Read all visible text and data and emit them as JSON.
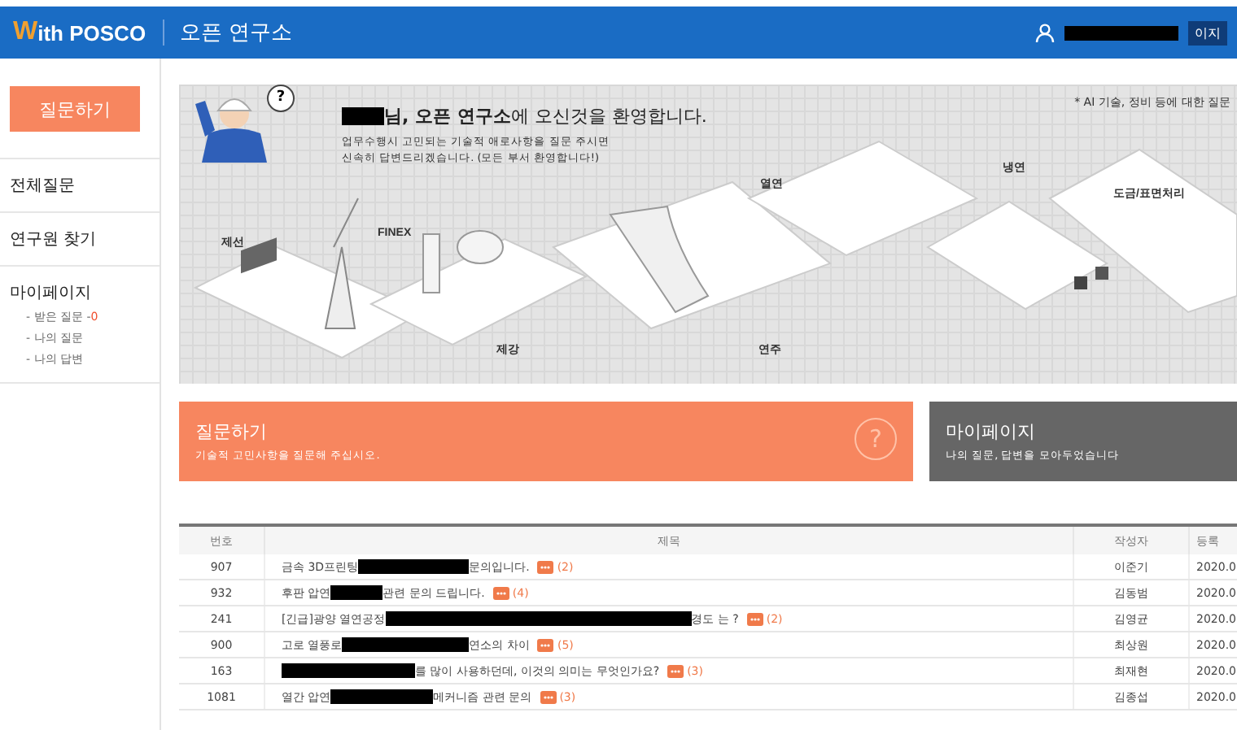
{
  "header": {
    "logo_mark": "W",
    "logo_text": "ith POSCO",
    "site_title": "오픈 연구소",
    "mypage_button": "이지"
  },
  "sidebar": {
    "ask_button": "질문하기",
    "menu": [
      {
        "label": "전체질문"
      },
      {
        "label": "연구원 찾기"
      },
      {
        "label": "마이페이지",
        "children": [
          {
            "label": "- 받은 질문 -",
            "count": "0"
          },
          {
            "label": "- 나의 질문"
          },
          {
            "label": "- 나의 답변"
          }
        ]
      }
    ]
  },
  "hero": {
    "welcome": "**님, 오픈 연구소**에 오신것을 환영합니다.",
    "description": [
      "업무수행시 고민되는 기술적 애로사항을 질문 주시면",
      "신속히 답변드리겠습니다. (모든 부서 환영합니다!)"
    ],
    "note": "* AI 기술, 정비 등에 대한 질문",
    "bubble_glyph": "?",
    "process_labels": [
      "제선",
      "FINEX",
      "제강",
      "연주",
      "열연",
      "냉연",
      "도금/표면처리"
    ]
  },
  "cards": [
    {
      "kind": "ask",
      "title": "질문하기",
      "subtitle": "기술적 고민사항을 질문해 주십시오.",
      "glyph": "?"
    },
    {
      "kind": "mypage",
      "title": "마이페이지",
      "subtitle": "나의 질문, 답변을 모아두었습니다"
    }
  ],
  "table": {
    "columns": [
      "번호",
      "제목",
      "작성자",
      "등록"
    ],
    "rows": [
      {
        "no": "907",
        "title": {
          "before": "금속 3D프린팅 ",
          "after": " 문의입니다.",
          "comments": "(2)"
        },
        "author": "이준기",
        "date": "2020.0"
      },
      {
        "no": "932",
        "title": {
          "before": "후판 압연 ",
          "after": "관련 문의 드립니다.",
          "comments": "(4)"
        },
        "author": "김동범",
        "date": "2020.0"
      },
      {
        "no": "241",
        "title": {
          "before": "[긴급]광양 열연공정 ",
          "after": " 경도 는 ?",
          "comments": "(2)"
        },
        "author": "김영균",
        "date": "2020.0"
      },
      {
        "no": "900",
        "title": {
          "before": "고로 열풍로 ",
          "after": "연소의 차이",
          "comments": "(5)"
        },
        "author": "최상원",
        "date": "2020.0"
      },
      {
        "no": "163",
        "title": {
          "after": "를 많이 사용하던데, 이것의 의미는 무엇인가요?",
          "comments": "(3)"
        },
        "author": "최재현",
        "date": "2020.0"
      },
      {
        "no": "1081",
        "title": {
          "before": "열간 압연 ",
          "after": " 메커니즘 관련 문의",
          "comments": "(3)"
        },
        "author": "김종섭",
        "date": "2020.0"
      }
    ]
  }
}
